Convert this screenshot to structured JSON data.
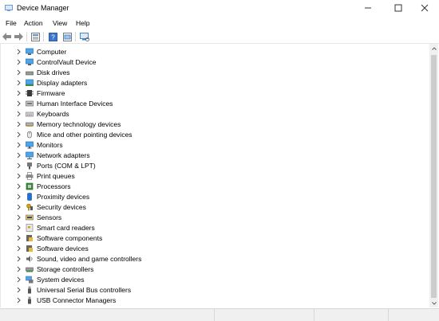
{
  "window": {
    "title": "Device Manager",
    "controls": [
      "minimize",
      "maximize",
      "close"
    ]
  },
  "menu": {
    "items": [
      {
        "label": "File"
      },
      {
        "label": "Action"
      },
      {
        "label": "View"
      },
      {
        "label": "Help"
      }
    ]
  },
  "toolbar": {
    "buttons": [
      "back-arrow-icon",
      "forward-arrow-icon",
      "properties-icon",
      "help-icon",
      "update-driver-icon",
      "scan-hardware-icon"
    ]
  },
  "tree": {
    "items": [
      {
        "label": "Computer",
        "icon": "computer-icon"
      },
      {
        "label": "ControlVault Device",
        "icon": "controlvault-icon"
      },
      {
        "label": "Disk drives",
        "icon": "disk-drive-icon"
      },
      {
        "label": "Display adapters",
        "icon": "display-adapter-icon"
      },
      {
        "label": "Firmware",
        "icon": "firmware-icon"
      },
      {
        "label": "Human Interface Devices",
        "icon": "hid-icon"
      },
      {
        "label": "Keyboards",
        "icon": "keyboard-icon"
      },
      {
        "label": "Memory technology devices",
        "icon": "memory-icon"
      },
      {
        "label": "Mice and other pointing devices",
        "icon": "mouse-icon"
      },
      {
        "label": "Monitors",
        "icon": "monitor-icon"
      },
      {
        "label": "Network adapters",
        "icon": "network-adapter-icon"
      },
      {
        "label": "Ports (COM & LPT)",
        "icon": "port-icon"
      },
      {
        "label": "Print queues",
        "icon": "printer-icon"
      },
      {
        "label": "Processors",
        "icon": "processor-icon"
      },
      {
        "label": "Proximity devices",
        "icon": "proximity-icon"
      },
      {
        "label": "Security devices",
        "icon": "security-icon"
      },
      {
        "label": "Sensors",
        "icon": "sensor-icon"
      },
      {
        "label": "Smart card readers",
        "icon": "smart-card-icon"
      },
      {
        "label": "Software components",
        "icon": "software-component-icon"
      },
      {
        "label": "Software devices",
        "icon": "software-device-icon"
      },
      {
        "label": "Sound, video and game controllers",
        "icon": "sound-icon"
      },
      {
        "label": "Storage controllers",
        "icon": "storage-controller-icon"
      },
      {
        "label": "System devices",
        "icon": "system-device-icon"
      },
      {
        "label": "Universal Serial Bus controllers",
        "icon": "usb-controller-icon"
      },
      {
        "label": "USB Connector Managers",
        "icon": "usb-connector-icon"
      }
    ]
  },
  "colors": {
    "accent_blue": "#1e88e5",
    "icon_gray": "#6f6f6f",
    "chevron": "#505050"
  }
}
